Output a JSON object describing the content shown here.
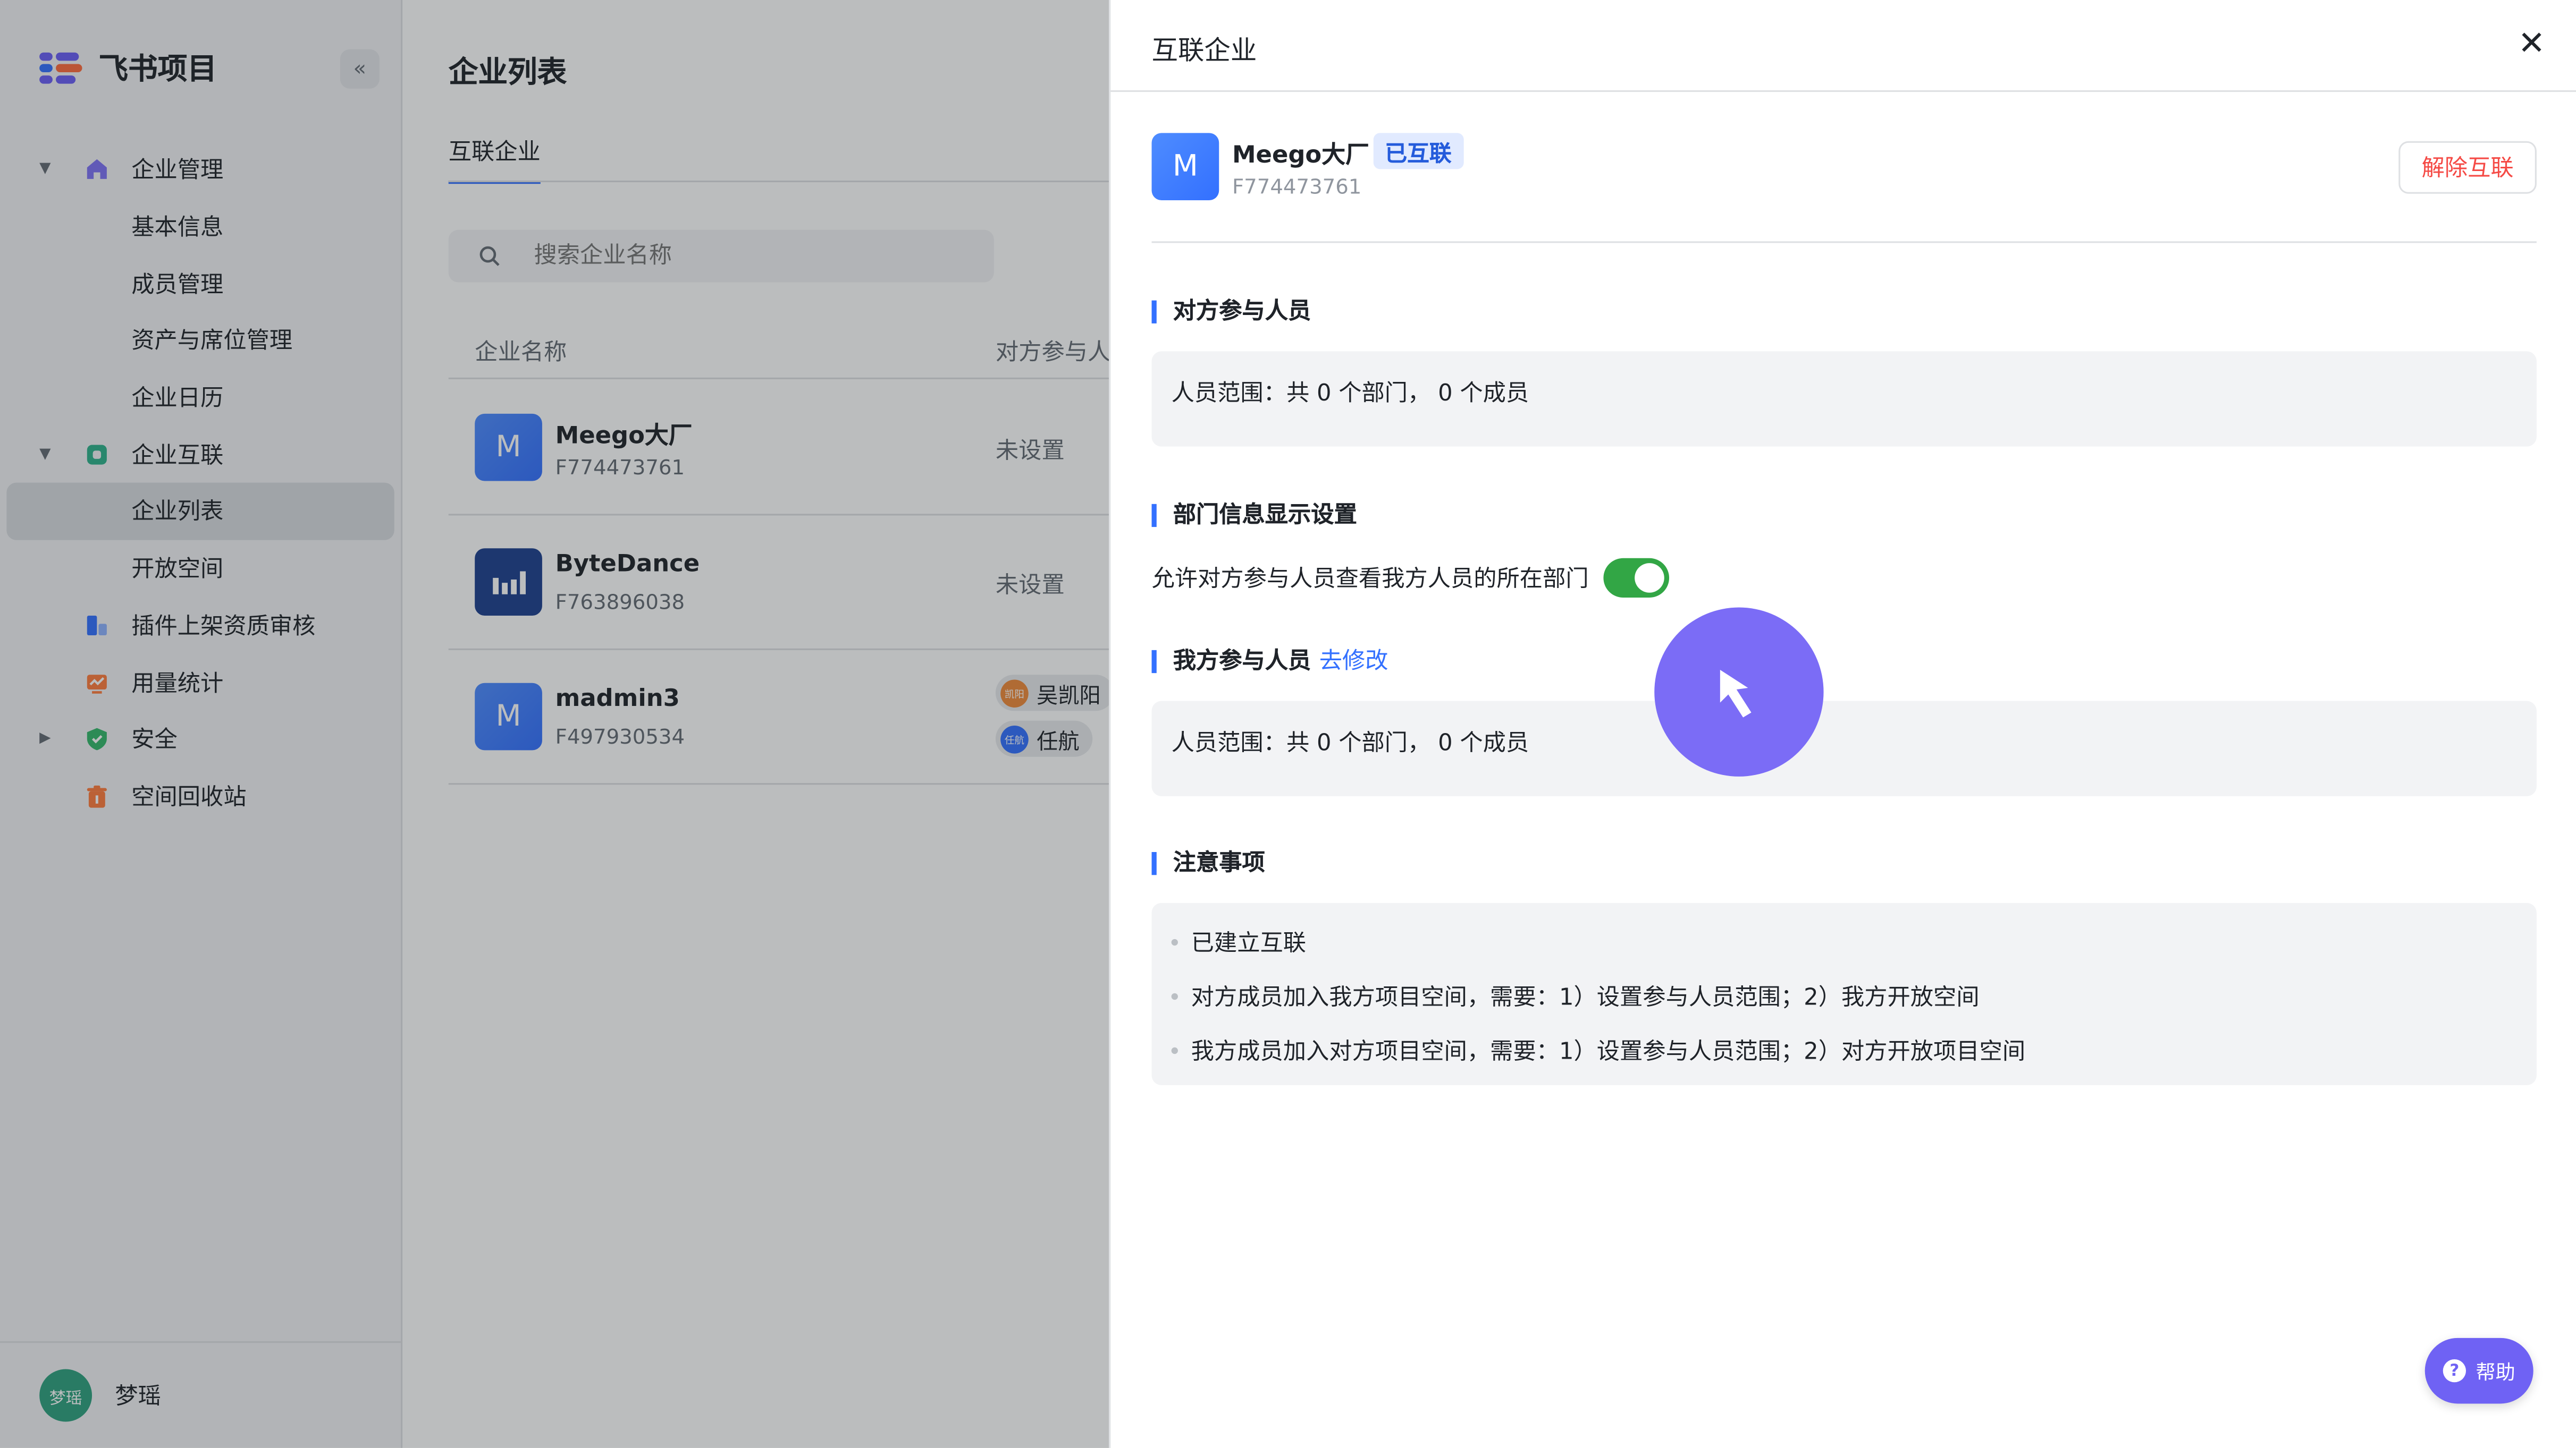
{
  "app": {
    "title": "飞书项目",
    "collapse_icon": "«"
  },
  "sidebar": {
    "items": [
      {
        "label": "企业管理",
        "icon": "home-icon",
        "expanded": true
      },
      {
        "label": "基本信息"
      },
      {
        "label": "成员管理"
      },
      {
        "label": "资产与席位管理"
      },
      {
        "label": "企业日历"
      },
      {
        "label": "企业互联",
        "icon": "link-icon",
        "expanded": true
      },
      {
        "label": "企业列表",
        "active": true
      },
      {
        "label": "开放空间"
      },
      {
        "label": "插件上架资质审核",
        "icon": "plugin-icon"
      },
      {
        "label": "用量统计",
        "icon": "chart-icon"
      },
      {
        "label": "安全",
        "icon": "shield-icon",
        "expanded": false
      },
      {
        "label": "空间回收站",
        "icon": "trash-icon"
      }
    ],
    "user": {
      "avatar_text": "梦瑶",
      "name": "梦瑶"
    }
  },
  "main": {
    "title": "企业列表",
    "tab": "互联企业",
    "search_placeholder": "搜索企业名称",
    "columns": [
      "企业名称",
      "对方参与人"
    ],
    "rows": [
      {
        "logo": "M",
        "name": "Meego大厂",
        "id": "F774473761",
        "scope": "未设置"
      },
      {
        "logo": "",
        "name": "ByteDance",
        "id": "F763896038",
        "scope": "未设置"
      },
      {
        "logo": "M",
        "name": "madmin3",
        "id": "F497930534",
        "members": [
          {
            "avatar": "凯阳",
            "name": "吴凯阳"
          },
          {
            "avatar": "任航",
            "name": "任航"
          }
        ]
      }
    ]
  },
  "drawer": {
    "title": "互联企业",
    "close_icon": "✕",
    "enterprise": {
      "logo": "M",
      "name": "Meego大厂",
      "badge": "已互联",
      "id": "F774473761"
    },
    "unlink_button": "解除互联",
    "other_members": {
      "title": "对方参与人员",
      "scope": "人员范围：共 0 个部门， 0 个成员"
    },
    "dept_display": {
      "title": "部门信息显示设置",
      "toggle_label": "允许对方参与人员查看我方人员的所在部门",
      "toggle_on": true
    },
    "our_members": {
      "title": "我方参与人员",
      "edit_link": "去修改",
      "scope": "人员范围：共 0 个部门， 0 个成员"
    },
    "notes": {
      "title": "注意事项",
      "items": [
        "已建立互联",
        "对方成员加入我方项目空间，需要：1）设置参与人员范围；2）我方开放空间",
        "我方成员加入对方项目空间，需要：1）设置参与人员范围；2）对方开放项目空间"
      ]
    }
  },
  "help": {
    "label": "帮助",
    "icon": "?"
  },
  "colors": {
    "accent": "#3370ff",
    "toggle_on": "#32a645",
    "danger": "#f54a45",
    "cursor": "#7b6cf6"
  }
}
